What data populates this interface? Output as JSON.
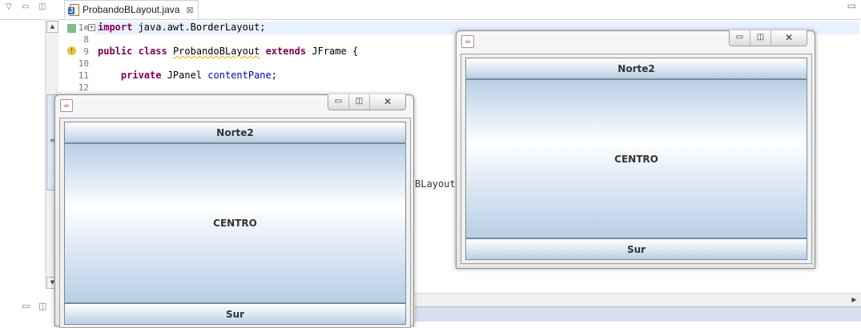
{
  "editor": {
    "tab_title": "ProbandoBLayout.java",
    "tab_close": "⊠",
    "code_lines": [
      {
        "num": "1⊕",
        "text": "import java.awt.BorderLayout;"
      },
      {
        "num": "8",
        "text": ""
      },
      {
        "num": "9",
        "text": "public class ProbandoBLayout extends JFrame {"
      },
      {
        "num": "10",
        "text": ""
      },
      {
        "num": "11",
        "text": "    private JPanel contentPane;"
      },
      {
        "num": "12",
        "text": ""
      }
    ],
    "code_fragment_partial": "BLayout("
  },
  "window_left": {
    "north_label": "Norte2",
    "center_label": "CENTRO",
    "south_label": "Sur"
  },
  "window_right": {
    "north_label": "Norte2",
    "center_label": "CENTRO",
    "south_label": "Sur"
  },
  "colors": {
    "keyword": "#7f0055",
    "field": "#0000c0",
    "button_blue": "#b8cfe5",
    "line_highlight": "#e8f2fe"
  },
  "icons": [
    "chevron-down-icon",
    "minimize-icon",
    "maximize-icon",
    "java-file-icon",
    "close-icon",
    "java-app-icon",
    "warning-icon"
  ]
}
